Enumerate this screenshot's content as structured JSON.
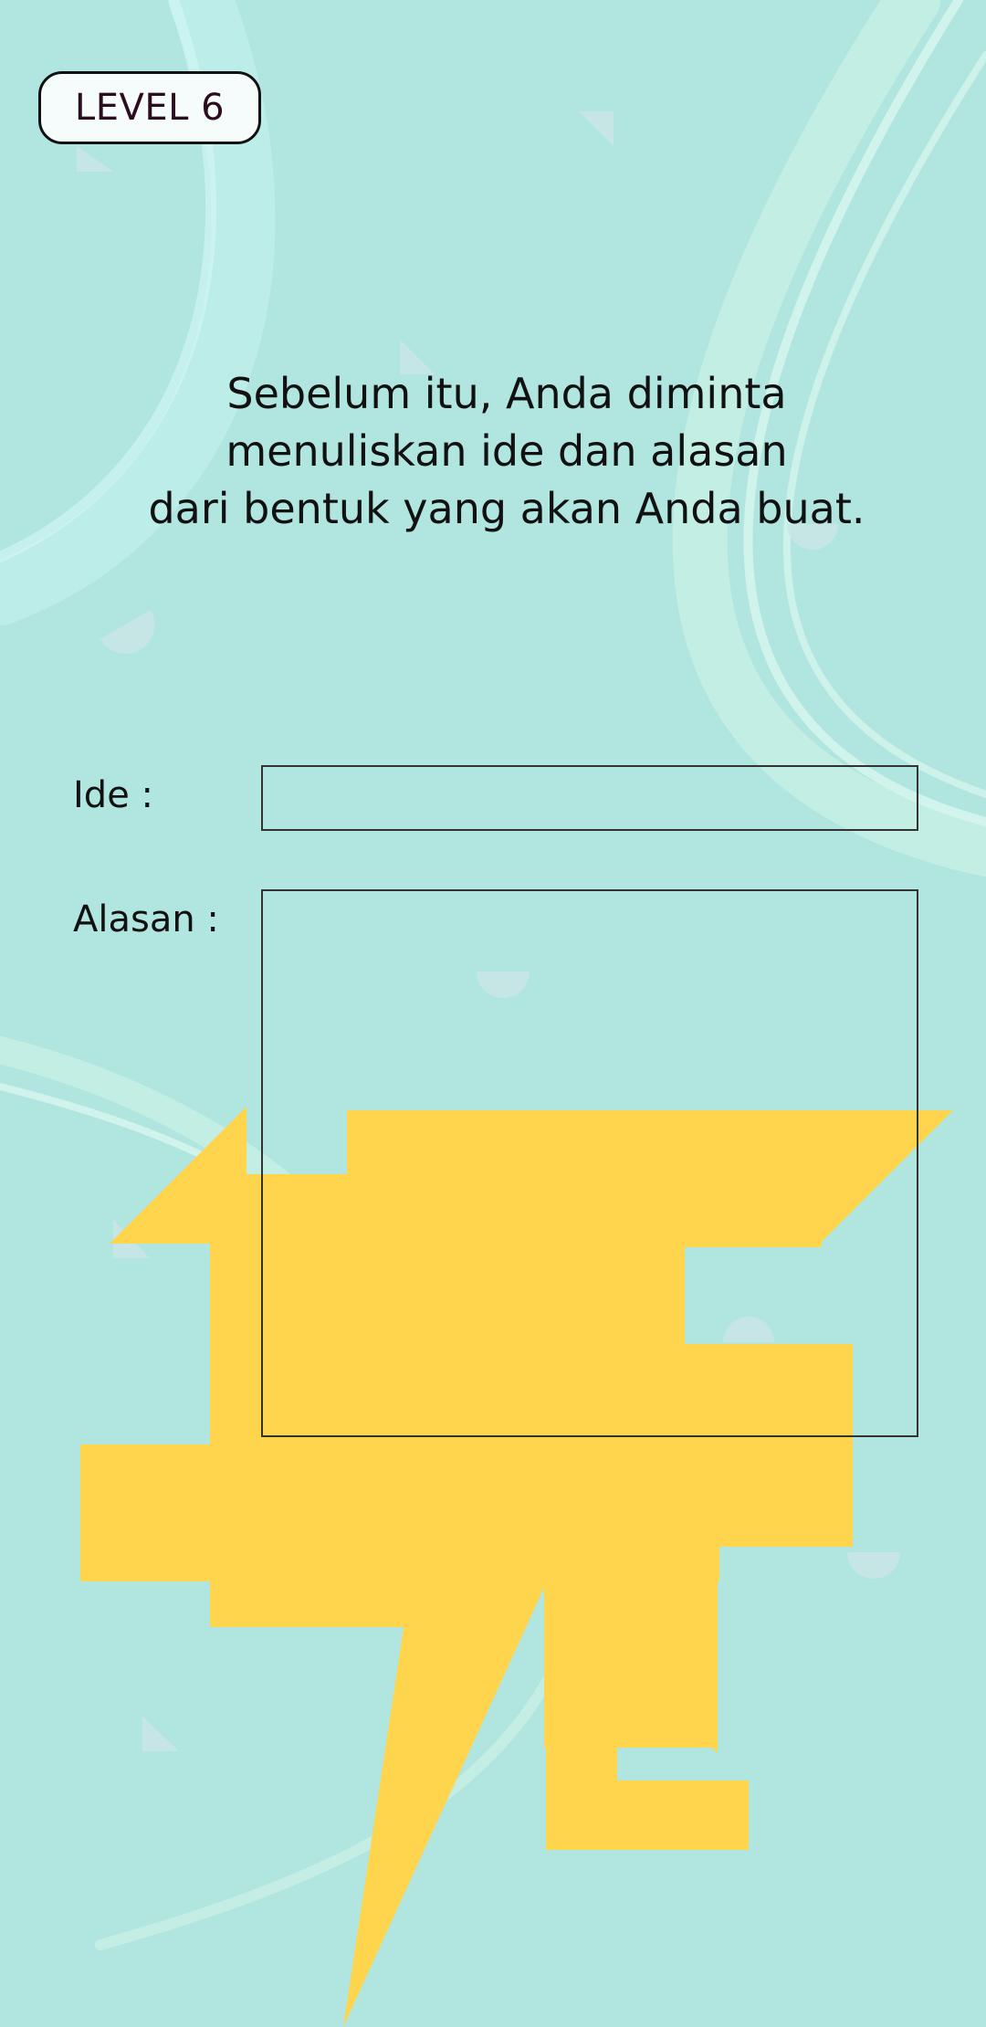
{
  "level": {
    "label": "LEVEL 6"
  },
  "instruction": {
    "lines": [
      "Sebelum itu, Anda diminta",
      "menuliskan ide dan alasan",
      "dari bentuk yang akan Anda buat."
    ]
  },
  "form": {
    "ide_label": "Ide  :",
    "alasan_label": "Alasan  :",
    "ide_value": "",
    "alasan_value": ""
  },
  "colors": {
    "background": "#b1e6e0",
    "shape": "#fed54c",
    "badge_text": "#2c0d1f"
  }
}
